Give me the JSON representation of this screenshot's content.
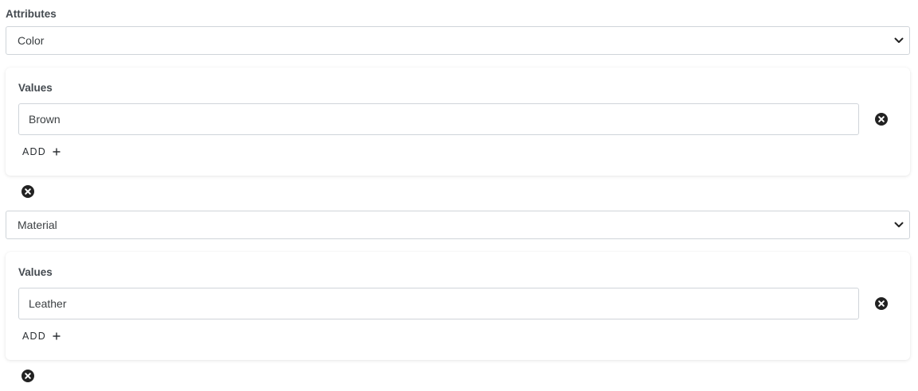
{
  "attributes_label": "Attributes",
  "attributes": [
    {
      "selected": "Color",
      "values_label": "Values",
      "values": [
        "Brown"
      ],
      "add_label": "ADD",
      "add_icon": "plus-icon"
    },
    {
      "selected": "Material",
      "values_label": "Values",
      "values": [
        "Leather"
      ],
      "add_label": "ADD",
      "add_icon": "plus-icon"
    }
  ],
  "icons": {
    "remove": "close-circle-icon",
    "select": "chevron-down-icon"
  },
  "colors": {
    "icon": "#222222",
    "border": "#cfd4d9",
    "text": "#3c4043"
  }
}
